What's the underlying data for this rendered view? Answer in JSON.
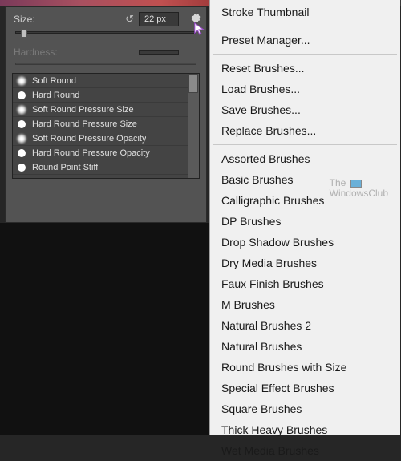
{
  "panel": {
    "size_label": "Size:",
    "size_value": "22 px",
    "hardness_label": "Hardness:",
    "hardness_value": ""
  },
  "brushes": [
    {
      "name": "Soft Round",
      "style": "soft"
    },
    {
      "name": "Hard Round",
      "style": "hard"
    },
    {
      "name": "Soft Round Pressure Size",
      "style": "soft"
    },
    {
      "name": "Hard Round Pressure Size",
      "style": "hard"
    },
    {
      "name": "Soft Round Pressure Opacity",
      "style": "soft"
    },
    {
      "name": "Hard Round Pressure Opacity",
      "style": "hard"
    },
    {
      "name": "Round Point Stiff",
      "style": "hard"
    }
  ],
  "menu": {
    "group0": [
      "Stroke Thumbnail"
    ],
    "group1": [
      "Preset Manager..."
    ],
    "group2": [
      "Reset Brushes...",
      "Load Brushes...",
      "Save Brushes...",
      "Replace Brushes..."
    ],
    "group3": [
      "Assorted Brushes",
      "Basic Brushes",
      "Calligraphic Brushes",
      "DP Brushes",
      "Drop Shadow Brushes",
      "Dry Media Brushes",
      "Faux Finish Brushes",
      "M Brushes",
      "Natural Brushes 2",
      "Natural Brushes",
      "Round Brushes with Size",
      "Special Effect Brushes",
      "Square Brushes",
      "Thick Heavy Brushes",
      "Wet Media Brushes"
    ]
  },
  "watermark": {
    "line1": "The",
    "line2": "WindowsClub"
  }
}
